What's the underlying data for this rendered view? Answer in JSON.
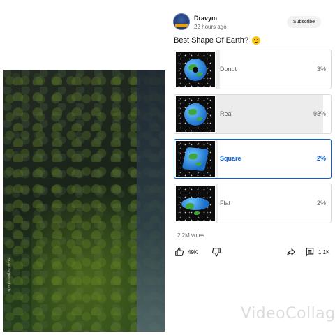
{
  "channel": {
    "name": "Dravym",
    "time": "22 hours ago",
    "subscribe_label": "Subscribe"
  },
  "poll": {
    "question": "Best Shape Of Earth?",
    "emoji": "thinking-face-emoji",
    "options": [
      {
        "label": "Donut",
        "percent": "3%",
        "share": 0.03,
        "selected": false,
        "image": "donut-earth"
      },
      {
        "label": "Real",
        "percent": "93%",
        "share": 0.93,
        "selected": false,
        "image": "round-earth"
      },
      {
        "label": "Square",
        "percent": "2%",
        "share": 0.02,
        "selected": true,
        "image": "cube-earth"
      },
      {
        "label": "Flat",
        "percent": "2%",
        "share": 0.02,
        "selected": false,
        "image": "flat-earth"
      }
    ],
    "votes": "2.2M votes"
  },
  "actions": {
    "likes": "49K",
    "comments": "1.1K"
  },
  "video": {
    "edge_text": "scan.hypercube.bf"
  },
  "watermark": "VideoCollage",
  "colors": {
    "accent": "#065fd4",
    "fill": "#ececec",
    "text_secondary": "#606060"
  }
}
